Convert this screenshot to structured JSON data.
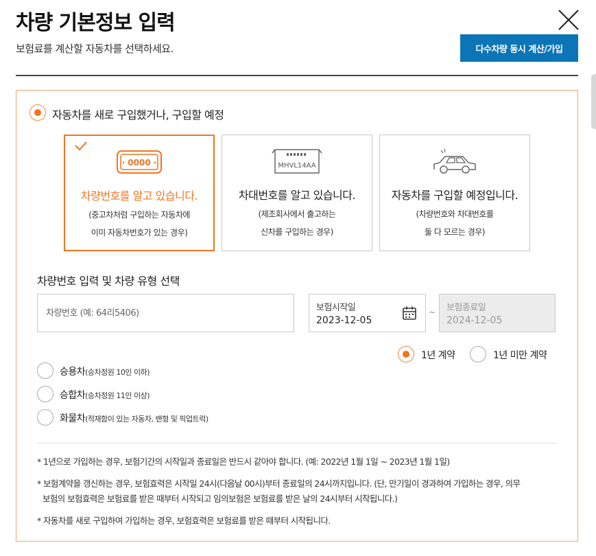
{
  "header": {
    "title": "차량 기본정보 입력",
    "subtitle": "보험료를 계산할 자동차를 선택하세요.",
    "multi_button": "다수차량 동시 계산/가입"
  },
  "main_option": {
    "label": "자동차를 새로 구입했거나, 구입할 예정",
    "selected": true
  },
  "cards": [
    {
      "icon": "license-plate-icon",
      "plate_text": "· 0000 ·",
      "title": "차량번호를 알고 있습니다.",
      "desc1": "(중고차처럼 구입하는 자동차에",
      "desc2": "이미 자동차번호가 있는 경우)",
      "selected": true
    },
    {
      "icon": "vin-plate-icon",
      "plate_text": "MHVL14AA",
      "title": "차대번호를 알고 있습니다.",
      "desc1": "(제조회사에서 출고하는",
      "desc2": "신차를 구입하는 경우)",
      "selected": false
    },
    {
      "icon": "car-icon",
      "title": "자동차를 구입할 예정입니다.",
      "desc1": "(차량번호와 차대번호를",
      "desc2": "둘 다 모르는 경우)",
      "selected": false
    }
  ],
  "section": {
    "title": "차량번호 입력 및 차량 유형 선택",
    "plate_placeholder": "차량번호 (예: 64리5406)",
    "start": {
      "label": "보험시작일",
      "value": "2023-12-05"
    },
    "tilde": "~",
    "end": {
      "label": "보험종료일",
      "value": "2024-12-05"
    }
  },
  "term": [
    {
      "label": "1년 계약",
      "selected": true
    },
    {
      "label": "1년 미만 계약",
      "selected": false
    }
  ],
  "car_types": [
    {
      "label": "승용차",
      "sub": "(승차정원 10인 이하)"
    },
    {
      "label": "승합차",
      "sub": "(승차정원 11인 이상)"
    },
    {
      "label": "화물차",
      "sub": "(적재함이 있는 자동차, 밴형 및 픽업트럭)"
    }
  ],
  "notes": [
    "* 1년으로 가입하는 경우, 보험기간의 시작일과 종료일은 반드시 같아야 합니다. (예: 2022년 1월 1일 ~ 2023년 1월 1일)",
    "* 보험계약을 갱신하는 경우, 보험효력은 시작일 24시(다음날 00시)부터 종료일의 24시까지입니다. (단, 만기일이 경과하여 가입하는 경우, 의무",
    "보험의 보험효력은 보험료를 받은 때부터 시작되고 임의보험은 보험료를 받은 날의 24시부터 시작됩니다.)",
    "* 자동차를 새로 구입하여 가입하는 경우, 보험효력은 보험료를 받은 때부터 시작됩니다."
  ],
  "colors": {
    "accent": "#f07521",
    "button": "#0b75b8",
    "panel_border": "#f1a772"
  }
}
